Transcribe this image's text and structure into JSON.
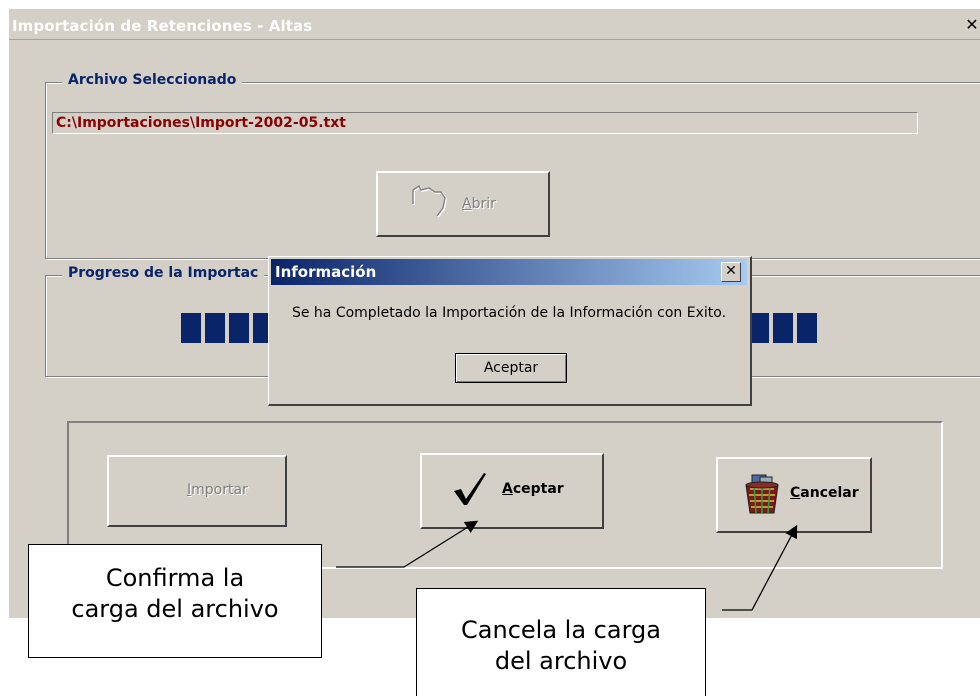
{
  "window": {
    "title": "Importación de Retenciones - Altas",
    "close_glyph": "✕"
  },
  "file_group": {
    "label": "Archivo Seleccionado",
    "path_value": "C:\\Importaciones\\Import-2002-05.txt",
    "open_button": {
      "label_first": "A",
      "label_rest": "brir",
      "icon": "folder-open-icon"
    }
  },
  "progress_group": {
    "label": "Progreso de la Importac",
    "progress_fraction": 1.0
  },
  "actions": {
    "import_button": {
      "label_first": "I",
      "label_rest": "mportar"
    },
    "accept_button": {
      "label_first": "A",
      "label_rest": "ceptar",
      "icon": "checkmark-icon"
    },
    "cancel_button": {
      "label_first": "C",
      "label_rest": "ancelar",
      "icon": "trash-bin-icon"
    }
  },
  "dialog": {
    "title": "Información",
    "message": "Se ha Completado la Importación de la Información con Exito.",
    "ok_label": "Aceptar",
    "close_glyph": "✕"
  },
  "callouts": {
    "confirm": {
      "line1": "Confirma la",
      "line2": "carga del archivo"
    },
    "cancel": {
      "line1": "Cancela la carga",
      "line2": "del archivo"
    }
  },
  "colors": {
    "window_bg": "#d4d0c8",
    "group_label": "#0a246a",
    "path_text": "#8b0000",
    "progress": "#0a246a"
  }
}
